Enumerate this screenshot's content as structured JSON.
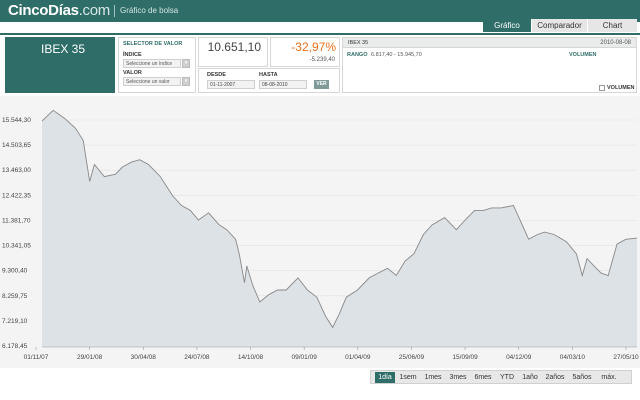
{
  "header": {
    "logo_main": "CincoDías",
    "logo_suffix": ".com",
    "subtitle": "Gráfico de bolsa",
    "tabs": [
      "Gráfico",
      "Comparador",
      "Chart"
    ]
  },
  "index_box": {
    "name": "IBEX 35"
  },
  "selector": {
    "title": "SELECTOR DE VALOR",
    "index_label": "ÍNDICE",
    "index_value": "Seleccione un índice",
    "value_label": "VALOR",
    "value_value": "Seleccione un valor"
  },
  "quote": {
    "price": "10.651,10",
    "change_pct": "-32,97%",
    "change_abs": "-5.239,40"
  },
  "dates": {
    "from_label": "DESDE",
    "from_value": "01-11-2007",
    "to_label": "HASTA",
    "to_value": "08-08-2010",
    "button": "VER"
  },
  "info": {
    "name": "IBEX 35",
    "date": "2010-08-08",
    "range_label": "RANGO",
    "range_value": "6.817,40 - 15.945,70",
    "volume_label": "VOLUMEN",
    "volume_checkbox": "VOLUMEN"
  },
  "range_buttons": [
    "1día",
    "1sem",
    "1mes",
    "3mes",
    "6mes",
    "YTD",
    "1año",
    "2años",
    "5años",
    "máx."
  ],
  "range_active": "1día",
  "colors": {
    "accent": "#2f6e68",
    "negative": "#e8701a",
    "line": "#888888",
    "fill": "#dde2e6"
  },
  "chart_data": {
    "type": "area",
    "title": "",
    "xlabel": "",
    "ylabel": "",
    "y_ticks": [
      15544.3,
      14503.65,
      13463.0,
      12422.35,
      11381.7,
      10341.05,
      9300.4,
      8259.75,
      7219.1,
      6178.45
    ],
    "y_tick_labels": [
      "15.544,30",
      "14.503,65",
      "13.463,00",
      "12.422,35",
      "11.381,70",
      "10.341,05",
      "9.300,40",
      "8.259,75",
      "7.219,10",
      "6.178,45"
    ],
    "ylim": [
      6178.45,
      16000
    ],
    "x_ticks": [
      "01/11/07",
      "29/01/08",
      "30/04/08",
      "24/07/08",
      "14/10/08",
      "09/01/09",
      "01/04/09",
      "25/06/09",
      "15/09/09",
      "04/12/09",
      "04/03/10",
      "27/05/10"
    ],
    "x": [
      "2007-11-01",
      "2007-11-20",
      "2007-12-10",
      "2007-12-28",
      "2008-01-10",
      "2008-01-21",
      "2008-01-29",
      "2008-02-15",
      "2008-03-05",
      "2008-03-17",
      "2008-04-01",
      "2008-04-15",
      "2008-04-30",
      "2008-05-20",
      "2008-06-10",
      "2008-06-25",
      "2008-07-10",
      "2008-07-24",
      "2008-08-10",
      "2008-08-28",
      "2008-09-10",
      "2008-09-25",
      "2008-10-01",
      "2008-10-10",
      "2008-10-14",
      "2008-10-24",
      "2008-11-05",
      "2008-11-20",
      "2008-12-05",
      "2008-12-20",
      "2009-01-09",
      "2009-01-25",
      "2009-02-10",
      "2009-02-25",
      "2009-03-09",
      "2009-03-20",
      "2009-04-01",
      "2009-04-20",
      "2009-05-10",
      "2009-05-25",
      "2009-06-10",
      "2009-06-25",
      "2009-07-10",
      "2009-07-25",
      "2009-08-10",
      "2009-08-25",
      "2009-09-15",
      "2009-10-05",
      "2009-10-20",
      "2009-11-05",
      "2009-11-20",
      "2009-12-04",
      "2009-12-20",
      "2010-01-10",
      "2010-01-25",
      "2010-02-05",
      "2010-02-20",
      "2010-03-04",
      "2010-03-20",
      "2010-04-10",
      "2010-04-27",
      "2010-05-07",
      "2010-05-15",
      "2010-05-27",
      "2010-06-08",
      "2010-06-20",
      "2010-07-05",
      "2010-07-20",
      "2010-08-08"
    ],
    "values": [
      15500,
      15945,
      15600,
      15200,
      14700,
      13000,
      13700,
      13200,
      13300,
      13600,
      13800,
      13900,
      13700,
      13200,
      12400,
      12000,
      11800,
      11400,
      11700,
      11200,
      11000,
      10600,
      10000,
      8800,
      9500,
      8700,
      8000,
      8300,
      8500,
      8500,
      9000,
      8500,
      8200,
      7400,
      6950,
      7500,
      8200,
      8500,
      9000,
      9200,
      9400,
      9100,
      9700,
      10000,
      10800,
      11200,
      11500,
      11000,
      11400,
      11800,
      11800,
      11900,
      11900,
      12000,
      11200,
      10600,
      10800,
      10900,
      10800,
      10500,
      10000,
      9100,
      9800,
      9500,
      9200,
      9100,
      10400,
      10600,
      10651
    ]
  }
}
